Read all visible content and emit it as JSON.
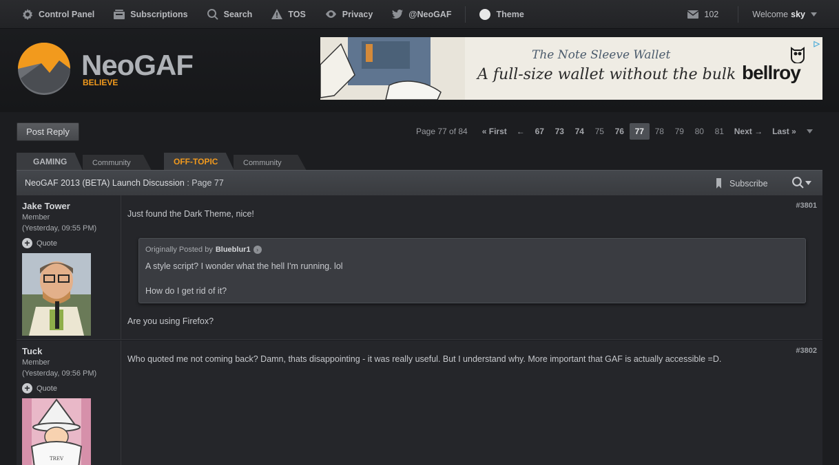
{
  "topnav": {
    "items": [
      {
        "label": "Control Panel",
        "icon": "gear-icon"
      },
      {
        "label": "Subscriptions",
        "icon": "subscriptions-icon"
      },
      {
        "label": "Search",
        "icon": "search-icon"
      },
      {
        "label": "TOS",
        "icon": "warning-icon"
      },
      {
        "label": "Privacy",
        "icon": "eye-icon"
      },
      {
        "label": "@NeoGAF",
        "icon": "twitter-icon"
      }
    ],
    "theme_label": "Theme",
    "messages_count": "102",
    "welcome_prefix": "Welcome",
    "username": "sky"
  },
  "header": {
    "logo_text": "NeoGAF",
    "logo_tagline": "BELIEVE",
    "ad": {
      "title": "The Note Sleeve Wallet",
      "subtitle": "A full-size wallet without the bulk",
      "brand": "bellroy"
    }
  },
  "controls": {
    "post_reply_label": "Post Reply",
    "page_info": "Page 77 of 84",
    "first_label": "« First",
    "prev_label": "←",
    "pages": [
      "67",
      "73",
      "74",
      "75",
      "76",
      "77",
      "78",
      "79",
      "80",
      "81"
    ],
    "current_page": "77",
    "next_label": "Next →",
    "last_label": "Last »"
  },
  "tabs": [
    {
      "label": "GAMING"
    },
    {
      "label": "Community"
    },
    {
      "label": "OFF-TOPIC"
    },
    {
      "label": "Community"
    }
  ],
  "thread": {
    "title": "NeoGAF 2013 (BETA) Launch Discussion",
    "page_suffix": ": Page 77",
    "subscribe_label": "Subscribe"
  },
  "posts": [
    {
      "author": "Jake Tower",
      "role": "Member",
      "time": "(Yesterday, 09:55 PM)",
      "quote_label": "Quote",
      "number": "#3801",
      "text_before": "Just found the Dark Theme, nice!",
      "quote": {
        "prefix": "Originally Posted by",
        "author": "Blueblur1",
        "line1": "A style script? I wonder what the hell I'm running. lol",
        "line2": "How do I get rid of it?"
      },
      "text_after": "Are you using Firefox?"
    },
    {
      "author": "Tuck",
      "role": "Member",
      "time": "(Yesterday, 09:56 PM)",
      "quote_label": "Quote",
      "number": "#3802",
      "text": "Who quoted me not coming back? Damn, thats disappointing - it was really useful. But I understand why. More important that GAF is actually accessible =D.",
      "avatar_caption": "TREV"
    }
  ],
  "colors": {
    "accent": "#f29a1d",
    "background": "#1c1d20",
    "post_bg": "#25262a"
  }
}
